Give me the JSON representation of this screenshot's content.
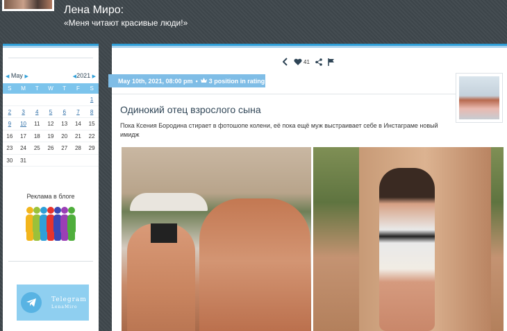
{
  "header": {
    "blog_title": "Лена Миро:",
    "blog_subtitle": "«Меня читают красивые люди!»"
  },
  "sidebar": {
    "calendar": {
      "month": "May",
      "year": "2021",
      "weekdays": [
        "S",
        "M",
        "T",
        "W",
        "T",
        "F",
        "S"
      ],
      "weeks": [
        [
          "",
          "",
          "",
          "",
          "",
          "",
          "1"
        ],
        [
          "2",
          "3",
          "4",
          "5",
          "6",
          "7",
          "8"
        ],
        [
          "9",
          "10",
          "11",
          "12",
          "13",
          "14",
          "15"
        ],
        [
          "16",
          "17",
          "18",
          "19",
          "20",
          "21",
          "22"
        ],
        [
          "23",
          "24",
          "25",
          "26",
          "27",
          "28",
          "29"
        ],
        [
          "30",
          "31",
          "",
          "",
          "",
          "",
          ""
        ]
      ],
      "linked_days": [
        "1",
        "2",
        "3",
        "4",
        "5",
        "6",
        "7",
        "8",
        "9",
        "10"
      ]
    },
    "ads_label": "Реклама в блоге",
    "telegram": {
      "title": "Telegram",
      "handle": "LenaMiro"
    }
  },
  "post": {
    "likes": "41",
    "date": "May 10th, 2021, 08:00 pm",
    "rating": "3 position in rating",
    "title": "Одинокий отец взрослого сына",
    "excerpt": "Пока Ксения Бородина стирает в фотошопе колени, её пока ещё муж выстраивает себе в Инстаграме новый имидж"
  },
  "colors": {
    "accent": "#2f9fd8",
    "meta_bar": "#7fbde6",
    "calendar_header": "#7cc4ec",
    "background": "#3f474c"
  }
}
